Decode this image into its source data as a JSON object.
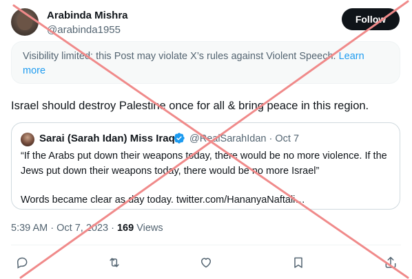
{
  "author": {
    "name": "Arabinda Mishra",
    "handle": "@arabinda1955"
  },
  "follow_button": "Follow",
  "notice": {
    "text": "Visibility limited: this Post may violate X’s rules against Violent Speech.",
    "link": "Learn more"
  },
  "post_text": "Israel should destroy Palestine once for all & bring peace in this region.",
  "quote": {
    "name": "Sarai (Sarah Idan) Miss Iraq",
    "handle": "@RealSarahIdan",
    "separator": "·",
    "date": "Oct 7",
    "line1": "“If the Arabs put down their weapons today, there would be no more violence. If the Jews put down their weapons today, there would be no more Israel”",
    "line2": "Words became clear as day today. twitter.com/HananyaNaftali…"
  },
  "meta": {
    "time": "5:39 AM",
    "separator": "·",
    "date": "Oct 7, 2023",
    "separator2": "·",
    "views_count": "169",
    "views_label": "Views"
  },
  "actions": [
    "reply-icon",
    "repost-icon",
    "like-icon",
    "bookmark-icon",
    "share-icon"
  ],
  "colors": {
    "accent": "#1d9bf0",
    "text": "#0f1419",
    "muted": "#536471",
    "overlay_x": "#f08a8a"
  }
}
